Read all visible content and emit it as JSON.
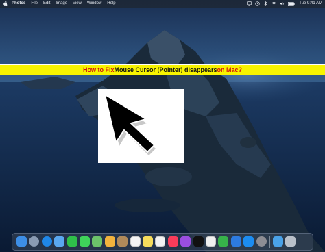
{
  "menubar": {
    "app_name": "Photos",
    "items": [
      "File",
      "Edit",
      "Image",
      "View",
      "Window",
      "Help"
    ],
    "clock": "Tue 9:41 AM",
    "status_icons": [
      "airplay-icon",
      "time-machine-icon",
      "bluetooth-icon",
      "wifi-icon",
      "volume-icon",
      "battery-icon"
    ]
  },
  "banner": {
    "part1": "How to Fix ",
    "part2": "Mouse Cursor (Pointer) disappears ",
    "part3": "on Mac?",
    "colors": {
      "background": "#f8f400",
      "red": "#d4120f",
      "dark": "#111111"
    }
  },
  "cursor_card": {
    "icon": "mouse-pointer-icon"
  },
  "dock": {
    "apps": [
      {
        "name": "finder",
        "color": "#3d8ee6"
      },
      {
        "name": "launchpad",
        "color": "#8a9bb3"
      },
      {
        "name": "safari",
        "color": "#1f87e8"
      },
      {
        "name": "mail",
        "color": "#5aa8f0"
      },
      {
        "name": "facetime",
        "color": "#2fbf4a"
      },
      {
        "name": "messages",
        "color": "#3fd35a"
      },
      {
        "name": "maps",
        "color": "#6cc36a"
      },
      {
        "name": "photos",
        "color": "#f2b33d"
      },
      {
        "name": "contacts",
        "color": "#b08a5a"
      },
      {
        "name": "calendar",
        "color": "#f4f4f4"
      },
      {
        "name": "notes",
        "color": "#f6dc5c"
      },
      {
        "name": "reminders",
        "color": "#f2f2f2"
      },
      {
        "name": "music",
        "color": "#fa3c5a"
      },
      {
        "name": "podcasts",
        "color": "#9b4ee0"
      },
      {
        "name": "tv",
        "color": "#111111"
      },
      {
        "name": "news",
        "color": "#f0f0f0"
      },
      {
        "name": "numbers",
        "color": "#37b34a"
      },
      {
        "name": "keynote",
        "color": "#2d7be0"
      },
      {
        "name": "app-store",
        "color": "#1c8cf0"
      },
      {
        "name": "system-preferences",
        "color": "#8d8d93"
      },
      {
        "name": "downloads",
        "color": "#4aa2e8"
      },
      {
        "name": "trash",
        "color": "#b9c0c9"
      }
    ]
  }
}
